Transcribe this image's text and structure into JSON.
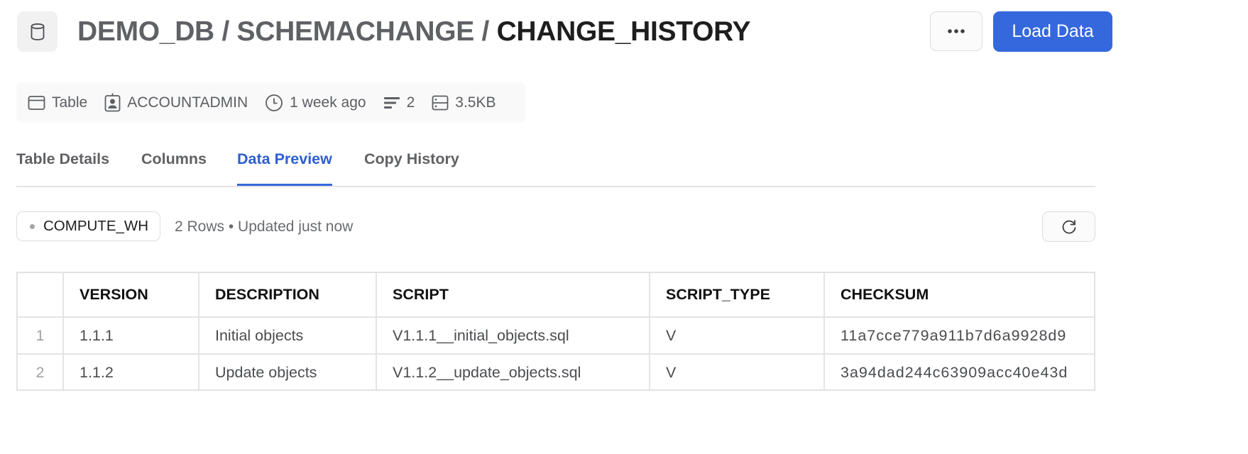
{
  "header": {
    "icon": "database-icon",
    "breadcrumb": [
      "DEMO_DB",
      "SCHEMACHANGE"
    ],
    "separator": " / ",
    "current": "CHANGE_HISTORY",
    "more_icon": "ellipsis-icon",
    "primary_button": "Load Data",
    "accent_color": "#3568dc"
  },
  "meta": {
    "type": {
      "icon": "table-icon",
      "label": "Table"
    },
    "owner": {
      "icon": "owner-badge-icon",
      "label": "ACCOUNTADMIN"
    },
    "modified": {
      "icon": "clock-icon",
      "label": "1 week ago"
    },
    "rows": {
      "icon": "rows-icon",
      "label": "2"
    },
    "size": {
      "icon": "storage-icon",
      "label": "3.5KB"
    }
  },
  "tabs": [
    {
      "label": "Table Details",
      "active": false
    },
    {
      "label": "Columns",
      "active": false
    },
    {
      "label": "Data Preview",
      "active": true
    },
    {
      "label": "Copy History",
      "active": false
    }
  ],
  "preview": {
    "warehouse": "COMPUTE_WH",
    "status": "2 Rows • Updated just now",
    "refresh_icon": "refresh-icon"
  },
  "grid": {
    "columns": [
      "VERSION",
      "DESCRIPTION",
      "SCRIPT",
      "SCRIPT_TYPE",
      "CHECKSUM"
    ],
    "rows": [
      {
        "num": "1",
        "cells": [
          "1.1.1",
          "Initial objects",
          "V1.1.1__initial_objects.sql",
          "V",
          "11a7cce779a911b7d6a9928d9"
        ]
      },
      {
        "num": "2",
        "cells": [
          "1.1.2",
          "Update objects",
          "V1.1.2__update_objects.sql",
          "V",
          "3a94dad244c63909acc40e43d"
        ]
      }
    ]
  }
}
